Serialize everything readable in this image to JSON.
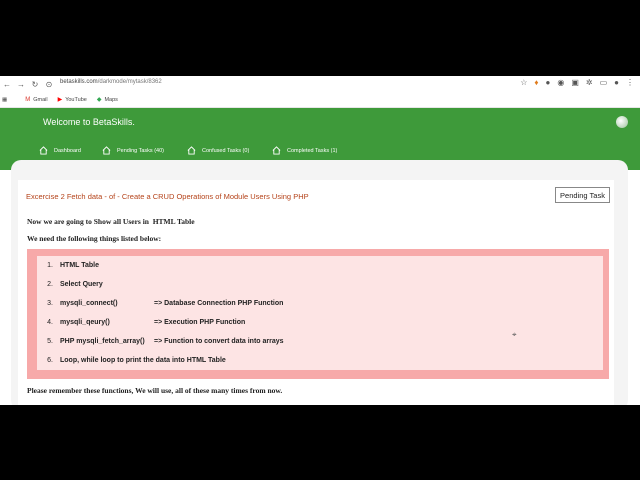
{
  "browser": {
    "url_domain": "betaskills.com",
    "url_path": "/darkmode/mytask/8362",
    "bookmarks": [
      {
        "label": "Gmail",
        "icon": "gmail-icon"
      },
      {
        "label": "YouTube",
        "icon": "youtube-icon"
      },
      {
        "label": "Maps",
        "icon": "maps-icon"
      }
    ]
  },
  "header": {
    "brand": "Welcome to BetaSkills."
  },
  "nav": {
    "items": [
      {
        "label": "Dashboard"
      },
      {
        "label": "Pending Tasks (40)"
      },
      {
        "label": "Confused Tasks (0)"
      },
      {
        "label": "Completed Tasks (1)"
      }
    ]
  },
  "task": {
    "title": "Excercise 2 Fetch data - of - Create a CRUD Operations of Module Users Using PHP",
    "status_button": "Pending Task",
    "intro": "Now we are going to Show all Users in  HTML Table",
    "list_heading": "We need the following things listed below:",
    "items": [
      {
        "num": "1.",
        "text": "HTML Table",
        "desc": ""
      },
      {
        "num": "2.",
        "text": "Select Query",
        "desc": ""
      },
      {
        "num": "3.",
        "text": "mysqli_connect()",
        "desc": "=> Database Connection PHP Function"
      },
      {
        "num": "4.",
        "text": "mysqli_qeury()",
        "desc": "=> Execution PHP Function"
      },
      {
        "num": "5.",
        "text": "PHP mysqli_fetch_array()",
        "desc": "=> Function to convert data into arrays"
      },
      {
        "num": "6.",
        "text": "Loop, while loop to print the data into HTML Table",
        "desc": ""
      }
    ],
    "footer": "Please remember these functions, We will use, all of these many times from now."
  },
  "colors": {
    "header_green": "#3e9a3a",
    "title_orange": "#b5431a",
    "list_border": "#f7a9a9",
    "list_bg": "#fde4e4"
  }
}
